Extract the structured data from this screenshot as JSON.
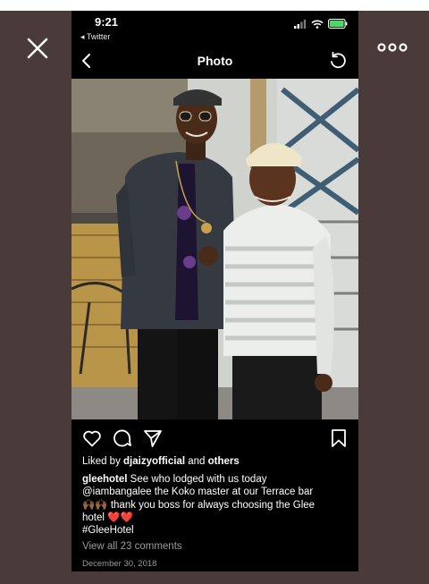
{
  "status_bar": {
    "time": "9:21",
    "back_app": "◂ Twitter"
  },
  "navbar": {
    "title": "Photo",
    "back_icon": "chevron-left-icon",
    "refresh_icon": "refresh-icon"
  },
  "viewer": {
    "close_icon": "close-icon",
    "more_icon": "more-icon"
  },
  "post": {
    "liked_prefix": "Liked by ",
    "liked_user": "djaizyofficial",
    "liked_and": " and ",
    "liked_others": "others",
    "caption_user": "gleehotel",
    "caption_line1": " See who lodged with us today",
    "caption_line2": "@iambangalee the Koko master at our Terrace bar",
    "caption_line3_emoji": "🙌🏾🙌🏾",
    "caption_line3": " thank you boss for always choosing the Glee",
    "caption_line4": "hotel ",
    "caption_line4_emoji": "❤️❤️",
    "hashtag": "#GleeHotel",
    "view_comments": "View all 23 comments",
    "date": "December 30, 2018"
  },
  "colors": {
    "background": "#4a3a39",
    "phone": "#000000",
    "battery_green": "#4cd964",
    "muted_text": "#9a9a9a"
  }
}
